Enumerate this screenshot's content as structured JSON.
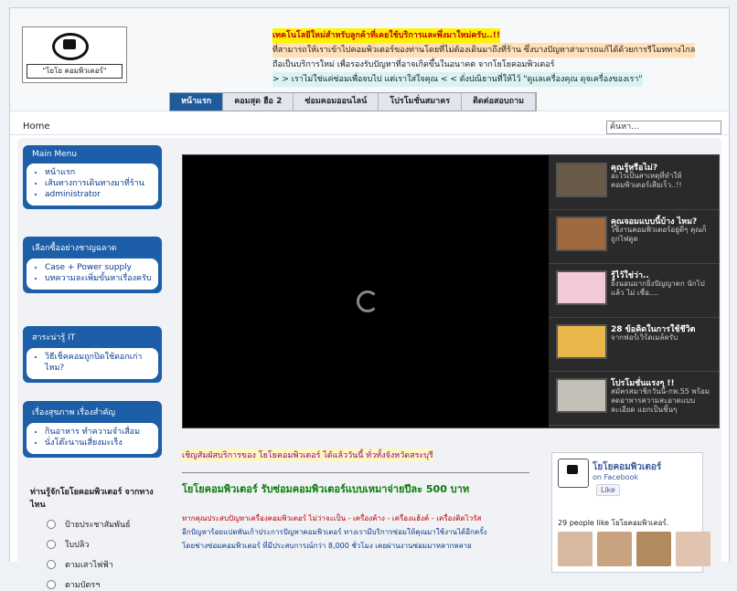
{
  "logo": {
    "caption": "\"โยโย คอมพิวเตอร์\""
  },
  "promo": {
    "line1": "เทคโนโลยีใหม่สำหรับลูกค้าที่เคยใช้บริการและพึ่งมาใหม่ครับ..!!",
    "line2": "ที่สามารถให้เราเข้าไปคอมพิวเตอร์ของท่านโดยที่ไม่ต้องเดินมาถึงที่ร้าน ซึ่งบางปัญหาสามารถแก้ได้ด้วยการรีโมททางไกล",
    "line3": "ถือเป็นบริการใหม่ เพื่อรองรับปัญหาที่อาจเกิดขึ้นในอนาคต จากโยโยคอมพิวเตอร์",
    "line4": "> > เราไม่ใช่แค่ซ่อมเพื่อจบไป แต่เราใส่ใจคุณ < < ดั่งปณิธานที่ให้ไว้ \"ดูแลเครื่องคุณ ดุจเครื่องของเรา\""
  },
  "nav": [
    "หน้าแรก",
    "คอมสุด ฮือ 2",
    "ซ่อมคอมออนไลน์",
    "โปรโมชั่นสมาคร",
    "ติดต่อสอบถาม"
  ],
  "breadcrumb": "Home",
  "search": {
    "value": "ค้นหา..."
  },
  "modules": [
    {
      "title": "Main Menu",
      "items": [
        "หน้าแรก",
        "เส้นทางการเดินทางมาที่ร้าน",
        "administrator"
      ]
    },
    {
      "title": "เลือกซื้ออย่างชาญฉลาด",
      "items": [
        "Case + Power supply",
        "บทความละเพิ่มขั้นหาเรื่องครับ"
      ]
    },
    {
      "title": "สาระน่ารู้ IT",
      "items": [
        "วิธีเช็คคอมถูกปิดใช้ดอกเก่าไหม?"
      ]
    },
    {
      "title": "เรื่องสุขภาพ เรื่องสำคัญ",
      "items": [
        "กินอาหาร ทำความจำเสื่อม",
        "นั่งโต๊ะนานเสี่ยงมะเร็ง"
      ]
    }
  ],
  "poll": {
    "question": "ท่านรู้จักโยโยคอมพิวเตอร์ จากทางไหน",
    "options": [
      "ป้ายประชาสัมพันธ์",
      "ใบปลิว",
      "ตามเสาไฟฟ้า",
      "ตามบัตรฯ"
    ]
  },
  "slider_items": [
    {
      "title": "คุณรู้หรือไม่?",
      "desc": "อะไรเป็นสาเหตุที่ทำให้คอมพิวเตอร์เสียเร็ว..!!"
    },
    {
      "title": "คุณจอมแบบนี้บ้าง ไหม?",
      "desc": "ใช้งานคอมพิวเตอร์อยู่ดีๆ คุณก็ถูกไฟดูด"
    },
    {
      "title": "รู้ไว้ใช่ว่า..",
      "desc": "ยิ่งนอนมากยิ่งปัญญาตก นักไปแล้ว ไม่ เชื่อ...."
    },
    {
      "title": "28 ข้อคิดในการใช้ชีวิต",
      "desc": "จากฟอร์เวิร์ดเมล์ครับ"
    },
    {
      "title": "โปรโมชั่นแรงๆ !!",
      "desc": "สมัครสมาชิกวันนี้-กพ.55 พร้อมลดอาหารความสะอาดแบบละเอียด แยกเป็นชิ้นๆ"
    }
  ],
  "main": {
    "invite": "เชิญสัมผัสบริการของ โยโยคอมพิวเตอร์ ได้แล้ววันนี้ ทั่วทั้งจังหวัดสระบุรี",
    "headline": "โยโยคอมพิวเตอร์ รับซ่อมคอมพิวเตอร์แบบเหมาจ่ายปีละ 500 บาท",
    "body1": "หากคุณประสบปัญหาเครื่องคอมพิวเตอร์ ไม่ว่าจะเป็น - เครื่องค้าง - เครื่องแฮ้งค์ - เครื่องติดไวรัส",
    "body2": "อีกปัญหาร้อยแปดพันเก้าประการปัญหาคอมพิวเตอร์ ทางเรามีบริการซ่อมให้คุณมาใช้งานได้อีกครั้ง",
    "body3": "โดยช่างซ่อมคอมพิวเตอร์ ที่มีประสบการณ์กว่า 8,000 ชั่วโมง เคยผ่านงานซ่อมมาหลากหลาย"
  },
  "facebook": {
    "name": "โยโยคอมพิวเตอร์",
    "on": "on Facebook",
    "like": "Like",
    "count": "29 people like โยโยคอมพิวเตอร์."
  }
}
